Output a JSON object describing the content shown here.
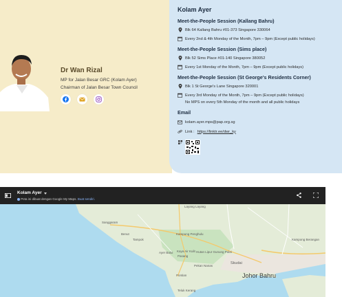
{
  "profile": {
    "name": "Dr Wan Rizal",
    "role_line1": "MP for Jalan Besar GRC (Kolam Ayer)",
    "role_line2": "Chairman of Jalan Besar Town Council",
    "socials": [
      "facebook-icon",
      "email-icon",
      "instagram-icon"
    ]
  },
  "contact": {
    "title": "Kolam Ayer",
    "sessions": [
      {
        "heading": "Meet-the-People Session (Kallang Bahru)",
        "address": "Blk 64 Kallang Bahru #01-373 Singapore 330064",
        "schedule": "Every 2nd & 4th Monday of the Month, 7pm – 9pm (Except public holidays)"
      },
      {
        "heading": "Meet-the-People Session (Sims place)",
        "address": "Blk 52 Sims Place #01-140 Singapore 380052",
        "schedule": "Every 1st Monday of the Month, 7pm – 9pm (Except public holidays)"
      },
      {
        "heading": "Meet-the-People Session (St George's Residents Corner)",
        "address": "Blk 1 St George's Lane Singapore 320001",
        "schedule": "Every 3rd Monday of the Month, 7pm – 9pm (Except public holidays)",
        "note": "No MPS on every 5th Monday of the month and all public holidays"
      }
    ],
    "email_heading": "Email",
    "email": "kolam.ayer.mps@pap.org.sg",
    "link_label": "Link : ",
    "link": "https://linktr.ee/dwr_ky"
  },
  "map": {
    "title": "Kolam Ayer",
    "notice": "Peta ini dibuat dengan Google My Maps.",
    "notice_link": "Buat sendiri.",
    "labels": {
      "layang": "Layang Layang",
      "sanggaram": "Sanggaram",
      "benut": "Benut",
      "tampok": "Tampok",
      "kampung": "Kampung Penghulu",
      "ayer_baloi": "Ayer Baloi",
      "raya": "Kaya Air Kulit",
      "pasang": "Pasang",
      "hutan": "Hutan Lipur Gunung Pulai",
      "pekan_nanas": "Pekan Nanas",
      "skudai": "Skudai",
      "pontian": "Pontian",
      "teluk": "Teluk Kerang",
      "kampung_e": "Kampong Berangan",
      "johor_bahru": "Johor Bahru"
    }
  }
}
